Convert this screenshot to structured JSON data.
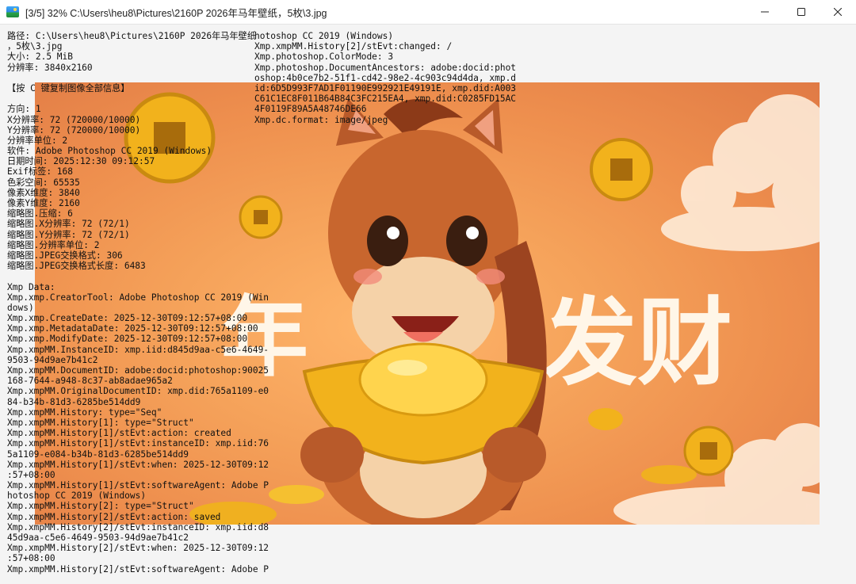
{
  "window": {
    "title": "[3/5] 32% C:\\Users\\heu8\\Pictures\\2160P 2026年马年壁纸，5枚\\3.jpg",
    "controls": {
      "minimize": "minimize-icon",
      "maximize": "maximize-icon",
      "close": "close-icon"
    }
  },
  "image": {
    "overlay_text": "发财",
    "overlay_text_left": "年"
  },
  "info_left": [
    "路径: C:\\Users\\heu8\\Pictures\\2160P 2026年马年壁纸",
    "，5枚\\3.jpg",
    "大小: 2.5 MiB",
    "分辨率: 3840x2160",
    "",
    "【按 C 键复制图像全部信息】",
    "",
    "方向: 1",
    "X分辨率: 72 (720000/10000)",
    "Y分辨率: 72 (720000/10000)",
    "分辨率单位: 2",
    "软件: Adobe Photoshop CC 2019 (Windows)",
    "日期时间: 2025:12:30 09:12:57",
    "Exif标签: 168",
    "色彩空间: 65535",
    "像素X维度: 3840",
    "像素Y维度: 2160",
    "缩略图.压缩: 6",
    "缩略图.X分辨率: 72 (72/1)",
    "缩略图.Y分辨率: 72 (72/1)",
    "缩略图.分辨率单位: 2",
    "缩略图.JPEG交换格式: 306",
    "缩略图.JPEG交换格式长度: 6483",
    "",
    "Xmp Data:",
    "Xmp.xmp.CreatorTool: Adobe Photoshop CC 2019 (Win",
    "dows)",
    "Xmp.xmp.CreateDate: 2025-12-30T09:12:57+08:00",
    "Xmp.xmp.MetadataDate: 2025-12-30T09:12:57+08:00",
    "Xmp.xmp.ModifyDate: 2025-12-30T09:12:57+08:00",
    "Xmp.xmpMM.InstanceID: xmp.iid:d845d9aa-c5e6-4649-",
    "9503-94d9ae7b41c2",
    "Xmp.xmpMM.DocumentID: adobe:docid:photoshop:90025",
    "168-7644-a948-8c37-ab8adae965a2",
    "Xmp.xmpMM.OriginalDocumentID: xmp.did:765a1109-e0",
    "84-b34b-81d3-6285be514dd9",
    "Xmp.xmpMM.History: type=\"Seq\"",
    "Xmp.xmpMM.History[1]: type=\"Struct\"",
    "Xmp.xmpMM.History[1]/stEvt:action: created",
    "Xmp.xmpMM.History[1]/stEvt:instanceID: xmp.iid:76",
    "5a1109-e084-b34b-81d3-6285be514dd9",
    "Xmp.xmpMM.History[1]/stEvt:when: 2025-12-30T09:12",
    ":57+08:00",
    "Xmp.xmpMM.History[1]/stEvt:softwareAgent: Adobe P",
    "hotoshop CC 2019 (Windows)",
    "Xmp.xmpMM.History[2]: type=\"Struct\"",
    "Xmp.xmpMM.History[2]/stEvt:action: saved",
    "Xmp.xmpMM.History[2]/stEvt:instanceID: xmp.iid:d8",
    "45d9aa-c5e6-4649-9503-94d9ae7b41c2",
    "Xmp.xmpMM.History[2]/stEvt:when: 2025-12-30T09:12",
    ":57+08:00",
    "Xmp.xmpMM.History[2]/stEvt:softwareAgent: Adobe P"
  ],
  "info_right": [
    "hotoshop CC 2019 (Windows)",
    "Xmp.xmpMM.History[2]/stEvt:changed: /",
    "Xmp.photoshop.ColorMode: 3",
    "Xmp.photoshop.DocumentAncestors: adobe:docid:phot",
    "oshop:4b0ce7b2-51f1-cd42-98e2-4c903c94d4da, xmp.d",
    "id:6D5D993F7AD1F01190E992921E49191E, xmp.did:A003",
    "C61C1EC8F011B64B84C3FC215EA4, xmp.did:C0285FD15AC",
    "4F0119F89A5A48746DE66",
    "Xmp.dc.format: image/jpeg"
  ]
}
